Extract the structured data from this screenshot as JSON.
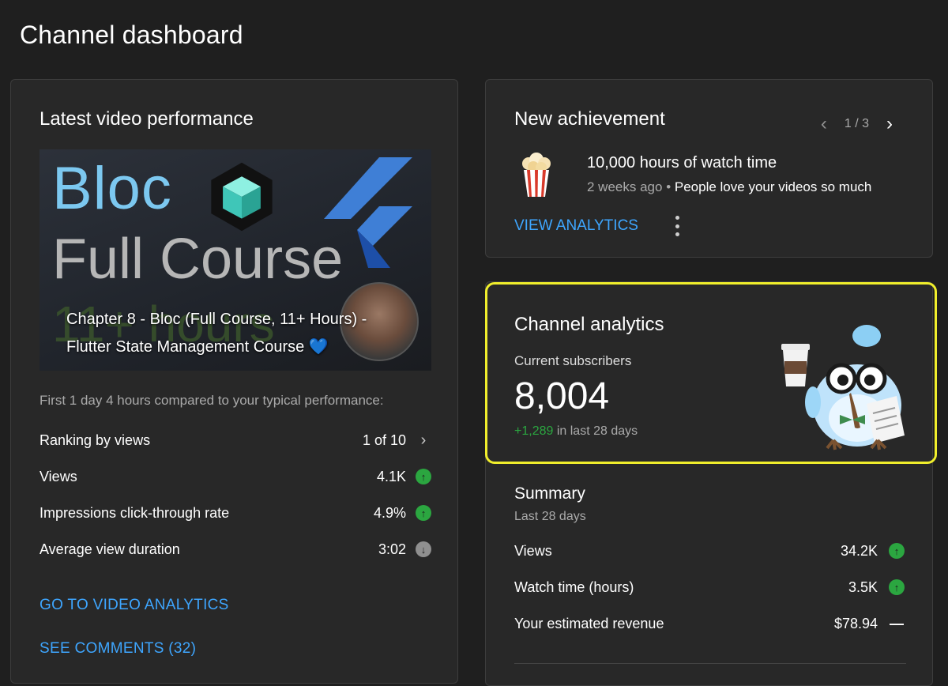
{
  "page": {
    "title": "Channel dashboard"
  },
  "latest_video": {
    "title": "Latest video performance",
    "thumbnail": {
      "line1": "Bloc",
      "line2": "Full Course",
      "line3": "11+ hours",
      "caption": "Chapter 8 - Bloc (Full Course, 11+ Hours) - Flutter State Management Course 💙"
    },
    "compare_text": "First 1 day 4 hours compared to your typical performance:",
    "metrics": [
      {
        "label": "Ranking by views",
        "value": "1 of 10",
        "indicator": "chevron"
      },
      {
        "label": "Views",
        "value": "4.1K",
        "indicator": "up"
      },
      {
        "label": "Impressions click-through rate",
        "value": "4.9%",
        "indicator": "up"
      },
      {
        "label": "Average view duration",
        "value": "3:02",
        "indicator": "down"
      }
    ],
    "go_to_analytics": "GO TO VIDEO ANALYTICS",
    "see_comments": "SEE COMMENTS (32)"
  },
  "achievement": {
    "title": "New achievement",
    "pager": "1 / 3",
    "name": "10,000 hours of watch time",
    "time": "2 weeks ago",
    "separator": "•",
    "message": "People love your videos so much",
    "link": "VIEW ANALYTICS"
  },
  "analytics": {
    "title": "Channel analytics",
    "subs_label": "Current subscribers",
    "subs_value": "8,004",
    "change_value": "+1,289",
    "change_suffix": "in last 28 days",
    "highlight_color": "#f0ee2c"
  },
  "summary": {
    "title": "Summary",
    "period": "Last 28 days",
    "rows": [
      {
        "label": "Views",
        "value": "34.2K",
        "indicator": "up"
      },
      {
        "label": "Watch time (hours)",
        "value": "3.5K",
        "indicator": "up"
      },
      {
        "label": "Your estimated revenue",
        "value": "$78.94",
        "indicator": "flat"
      }
    ]
  },
  "colors": {
    "accent_blue": "#3ea6ff",
    "up_green": "#2ba640",
    "background": "#1f1f1f",
    "card": "#282828"
  },
  "icons": [
    "popcorn-icon",
    "chevron-left-icon",
    "chevron-right-icon",
    "more-vert-icon",
    "arrow-up-icon",
    "arrow-down-icon",
    "dash-icon",
    "mascot-illustration"
  ]
}
